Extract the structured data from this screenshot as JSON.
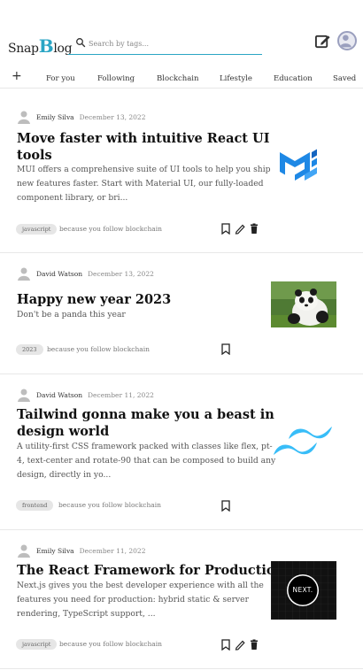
{
  "header": {
    "logo_prefix": "Snap",
    "logo_big": "B",
    "logo_suffix": "log",
    "search_placeholder": "Search by tags..."
  },
  "tabs": [
    "For you",
    "Following",
    "Blockchain",
    "Lifestyle",
    "Education",
    "Saved"
  ],
  "posts": [
    {
      "author": "Emily Silva",
      "date": "December 13, 2022",
      "title_lines": [
        "Move faster with intuitive React UI",
        "tools"
      ],
      "body_lines": [
        "MUI offers a comprehensive suite of UI tools to help you ship",
        "new features faster. Start with Material UI, our fully-loaded",
        "component library, or bri..."
      ],
      "tag": "javascript",
      "reason": "because you follow blockchain",
      "thumb": "mui-logo"
    },
    {
      "author": "David Watson",
      "date": "December 13, 2022",
      "title_lines": [
        "Happy new year 2023"
      ],
      "body_lines": [
        "Don't be a panda this year"
      ],
      "tag": "2023",
      "reason": "because you follow blockchain",
      "thumb": "panda-photo"
    },
    {
      "author": "David Watson",
      "date": "December 11, 2022",
      "title_lines": [
        "Tailwind gonna make you a beast in",
        "design world"
      ],
      "body_lines": [
        "A utility-first CSS framework packed with classes like flex, pt-",
        "4, text-center and rotate-90 that can be composed to build any",
        "design, directly in yo..."
      ],
      "tag": "frontend",
      "reason": "because you follow blockchain",
      "thumb": "tailwind-logo"
    },
    {
      "author": "Emily Silva",
      "date": "December 11, 2022",
      "title_lines": [
        "The React Framework for Production"
      ],
      "body_lines": [
        "Next.js gives you the best developer experience with all the",
        "features you need for production: hybrid static & server",
        "rendering, TypeScript support, ..."
      ],
      "tag": "javascript",
      "reason": "because you follow blockchain",
      "thumb": "nextjs-logo",
      "thumb_text": "NEXT."
    }
  ],
  "colors": {
    "accent": "#2aa5c4",
    "mui_blue": "#1e88e5",
    "tailwind_cyan": "#38bdf8",
    "text": "#222222"
  }
}
